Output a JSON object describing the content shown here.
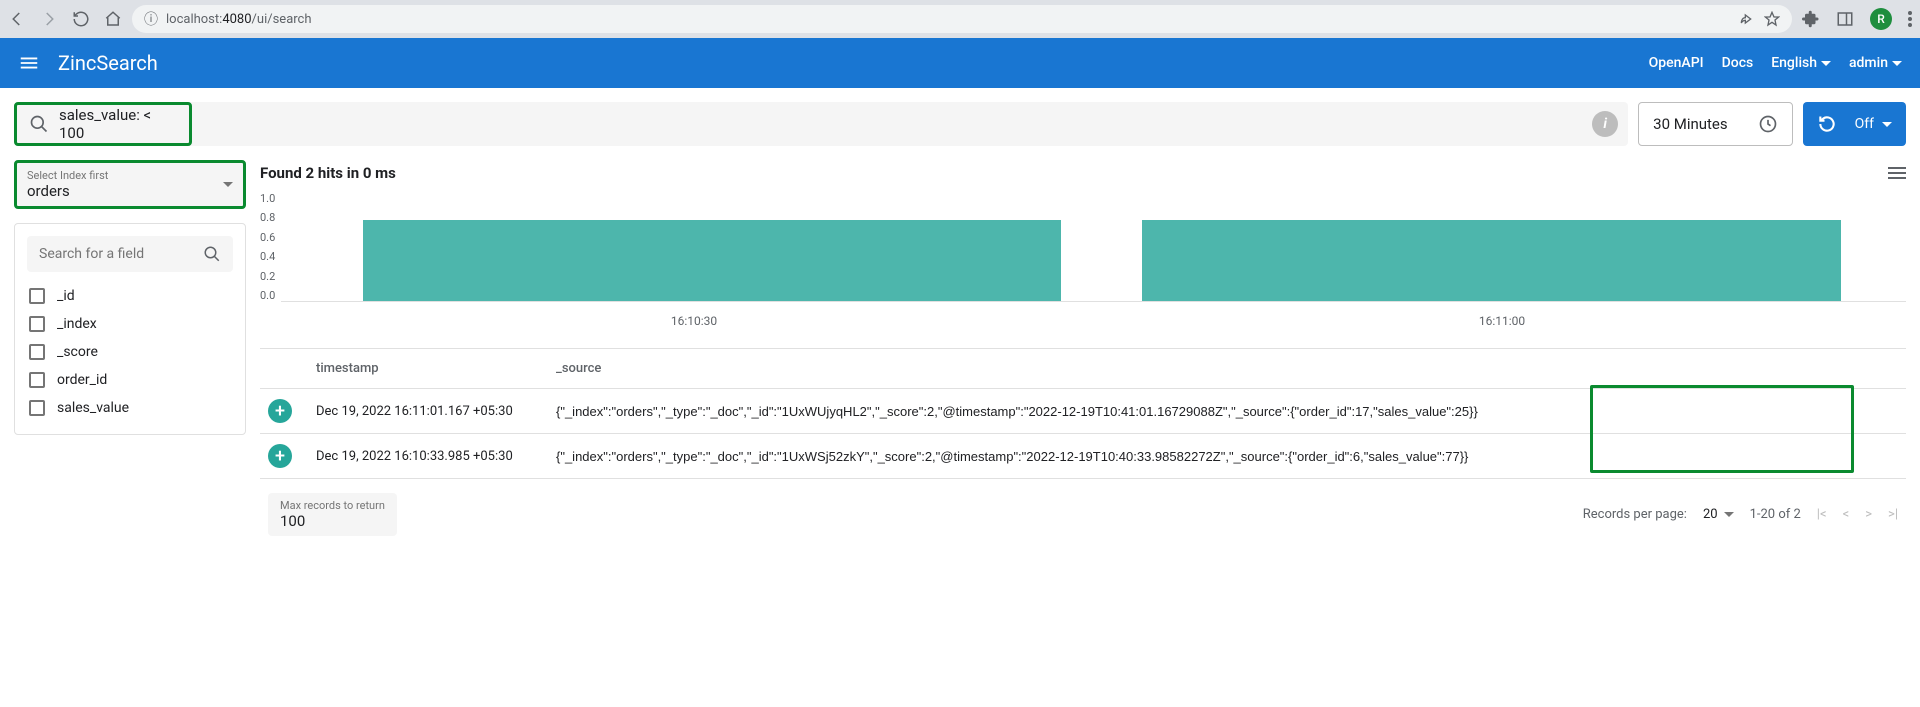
{
  "browser": {
    "url_host": "localhost:",
    "url_port": "4080",
    "url_path": "/ui/search",
    "avatar_letter": "R"
  },
  "header": {
    "brand": "ZincSearch",
    "links": {
      "openapi": "OpenAPI",
      "docs": "Docs",
      "language": "English",
      "user": "admin"
    }
  },
  "search": {
    "query": "sales_value: < 100",
    "time_range": "30 Minutes",
    "refresh_toggle": "Off"
  },
  "index_select": {
    "label": "Select Index first",
    "value": "orders"
  },
  "field_search": {
    "placeholder": "Search for a field"
  },
  "fields": [
    "_id",
    "_index",
    "_score",
    "order_id",
    "sales_value"
  ],
  "results": {
    "summary": "Found 2 hits in 0 ms"
  },
  "chart_data": {
    "type": "bar",
    "categories": [
      "16:10:30",
      "16:11:00"
    ],
    "values": [
      1,
      1
    ],
    "yticks": [
      "1.0",
      "0.8",
      "0.6",
      "0.4",
      "0.2",
      "0.0"
    ],
    "title": "",
    "xlabel": "",
    "ylabel": "",
    "ylim": [
      0,
      1
    ]
  },
  "table": {
    "columns": {
      "timestamp": "timestamp",
      "source": "_source"
    },
    "rows": [
      {
        "timestamp": "Dec 19, 2022 16:11:01.167 +05:30",
        "source": "{\"_index\":\"orders\",\"_type\":\"_doc\",\"_id\":\"1UxWUjyqHL2\",\"_score\":2,\"@timestamp\":\"2022-12-19T10:41:01.16729088Z\",\"_source\":{\"order_id\":17,\"sales_value\":25}}"
      },
      {
        "timestamp": "Dec 19, 2022 16:10:33.985 +05:30",
        "source": "{\"_index\":\"orders\",\"_type\":\"_doc\",\"_id\":\"1UxWSj52zkY\",\"_score\":2,\"@timestamp\":\"2022-12-19T10:40:33.98582272Z\",\"_source\":{\"order_id\":6,\"sales_value\":77}}"
      }
    ]
  },
  "footer": {
    "max_records_label": "Max records to return",
    "max_records_value": "100",
    "rpp_label": "Records per page:",
    "rpp_value": "20",
    "range": "1-20 of 2"
  }
}
